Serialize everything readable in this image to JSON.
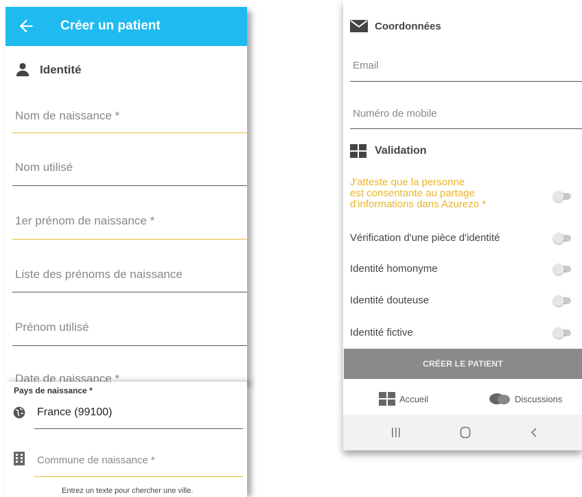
{
  "appbar": {
    "title": "Créer un patient"
  },
  "identity": {
    "section_title": "Identité",
    "fields": {
      "birth_name": "Nom de naissance *",
      "used_name": "Nom utilisé",
      "first_birth_firstname": "1er prénom de naissance *",
      "birth_firstnames_list": "Liste des prénoms de naissance",
      "used_firstname": "Prénom utilisé",
      "birth_date": "Date de naissance *"
    }
  },
  "birth_place": {
    "country_label": "Pays de naissance *",
    "country_value": "France (99100)",
    "city_placeholder": "Commune de naissance *",
    "city_hint": "Entrez un texte pour chercher une ville."
  },
  "contact": {
    "section_title": "Coordonnées",
    "email_placeholder": "Email",
    "mobile_placeholder": "Numéro de mobile"
  },
  "validation": {
    "section_title": "Validation",
    "consent_line1": "J'atteste que la personne",
    "consent_line2": "est consentante au partage",
    "consent_line3": "d'informations dans Azurezo *",
    "id_check": "Vérification d'une pièce d'identité",
    "homonym": "Identité homonyme",
    "doubtful": "Identité douteuse",
    "fictive": "Identité fictive"
  },
  "actions": {
    "create_label": "CRÉER LE PATIENT"
  },
  "bottom_nav": {
    "home": "Accueil",
    "discussions": "Discussions"
  },
  "colors": {
    "appbar": "#1ebaf0",
    "required_accent": "#e9bd2f",
    "button": "#8a8a8a"
  },
  "icons": [
    "back-arrow-icon",
    "person-icon",
    "globe-icon",
    "building-icon",
    "envelope-icon",
    "grid-icon",
    "chat-bubbles-icon",
    "recent-apps-icon",
    "home-circle-icon",
    "back-chevron-icon"
  ]
}
